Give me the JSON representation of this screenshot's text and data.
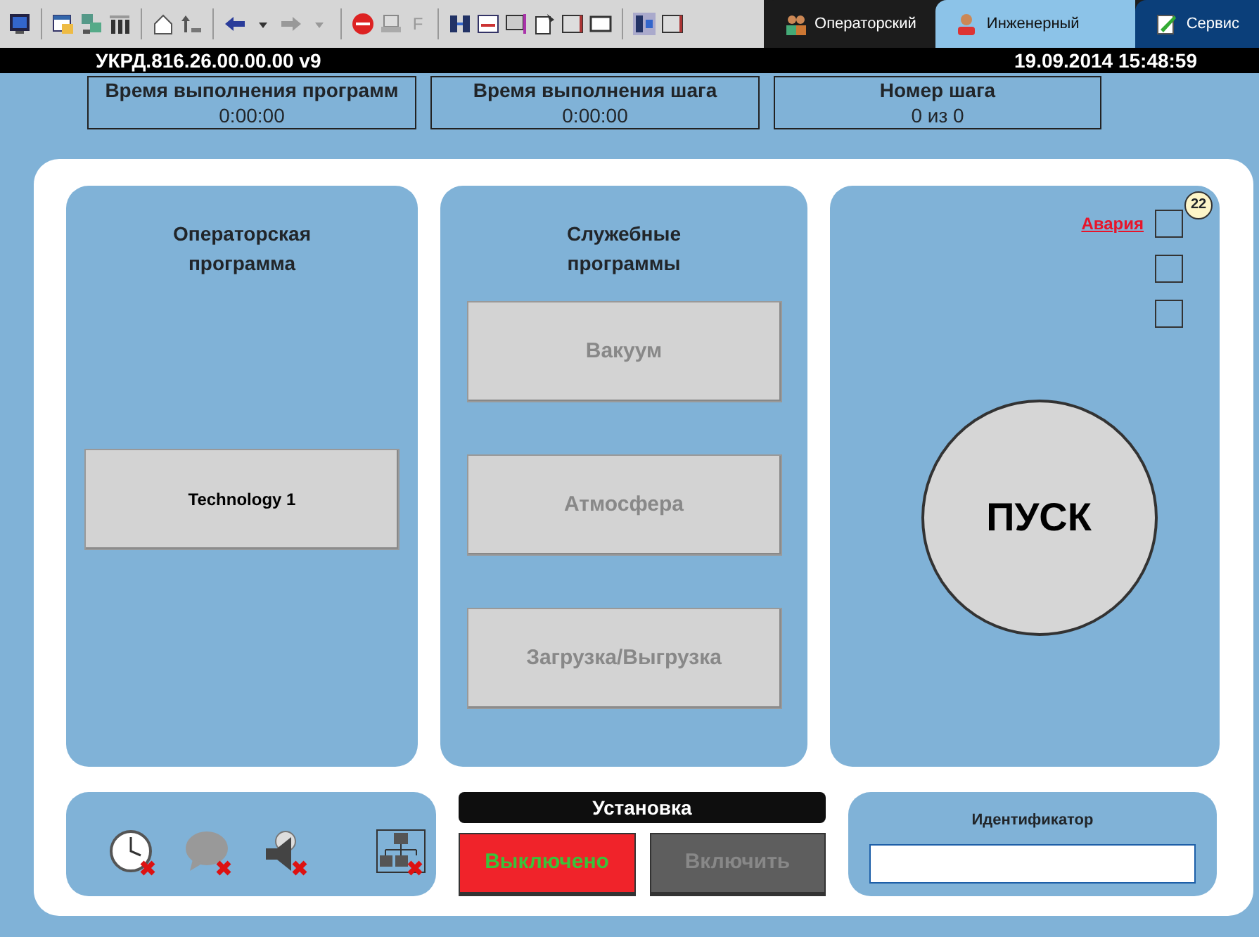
{
  "toolbar": {
    "f_button": {
      "label": "F",
      "disabled": true
    }
  },
  "tabs": [
    {
      "label": "Операторский",
      "selected": false,
      "color": "#1c1c1c"
    },
    {
      "label": "Инженерный",
      "selected": true,
      "color": "#8cc3e8"
    },
    {
      "label": "Сервис",
      "selected": false,
      "color": "#0b3f7a"
    }
  ],
  "header": {
    "title": "УКРД.816.26.00.00.00 v9",
    "datetime": "19.09.2014 15:48:59"
  },
  "info": [
    {
      "label": "Время выполнения программ",
      "value": "0:00:00"
    },
    {
      "label": "Время выполнения шага",
      "value": "0:00:00"
    },
    {
      "label": "Номер шага",
      "value": "0 из 0"
    }
  ],
  "operator_panel": {
    "title": "Операторская программа",
    "programs": [
      {
        "label": "Technology 1",
        "disabled": false
      }
    ]
  },
  "service_panel": {
    "title": "Служебные программы",
    "programs": [
      {
        "label": "Вакуум",
        "disabled": true
      },
      {
        "label": "Атмосфера",
        "disabled": true
      },
      {
        "label": "Загрузка/Выгрузка",
        "disabled": true
      }
    ]
  },
  "start_panel": {
    "alarm_link": "Авария",
    "alarm_count": "22",
    "indicators": [
      {
        "checked": false
      },
      {
        "checked": false
      },
      {
        "checked": false
      }
    ],
    "start_button": "ПУСК"
  },
  "status_icons": [
    {
      "kind": "clock",
      "error": true
    },
    {
      "kind": "sms",
      "error": true
    },
    {
      "kind": "speaker",
      "error": true
    },
    {
      "kind": "network",
      "error": true
    }
  ],
  "installation": {
    "title": "Установка",
    "buttons": [
      {
        "label": "Выключено",
        "active": true
      },
      {
        "label": "Включить",
        "active": false
      }
    ]
  },
  "identifier": {
    "label": "Идентификатор"
  }
}
